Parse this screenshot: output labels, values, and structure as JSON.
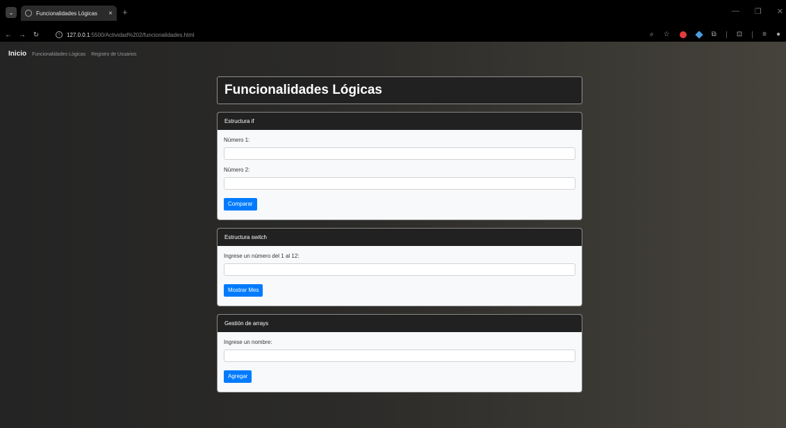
{
  "browser": {
    "tab_title": "Funcionalidades Lógicas",
    "url_host": "127.0.0.1",
    "url_rest": ":5500/Actividad%202/funcionalidades.html",
    "new_tab": "+",
    "tab_close": "×"
  },
  "navbar": {
    "brand": "Inicio",
    "links": [
      "Funcionalidades Lógicas",
      "Registro de Usuarios"
    ]
  },
  "main": {
    "title": "Funcionalidades Lógicas",
    "cards": [
      {
        "header": "Estructura if",
        "fields": [
          {
            "label": "Número 1:",
            "value": ""
          },
          {
            "label": "Número 2:",
            "value": ""
          }
        ],
        "button": "Comparar"
      },
      {
        "header": "Estructura switch",
        "fields": [
          {
            "label": "Ingrese un número del 1 al 12:",
            "value": ""
          }
        ],
        "button": "Mostrar Mes"
      },
      {
        "header": "Gestión de arrays",
        "fields": [
          {
            "label": "Ingrese un nombre:",
            "value": ""
          }
        ],
        "button": "Agregar"
      }
    ]
  },
  "colors": {
    "button_primary": "#007bff",
    "card_header": "#212121",
    "card_body": "#f8f9fa"
  }
}
